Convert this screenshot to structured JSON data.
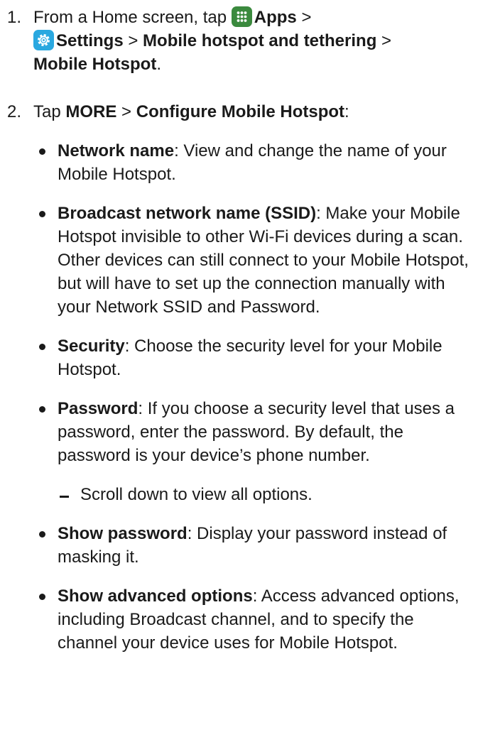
{
  "steps": [
    {
      "number": "1.",
      "intro": "From a Home screen, tap",
      "apps_label": "Apps",
      "sep1": " > ",
      "settings_label": "Settings",
      "sep2": " > ",
      "path3": "Mobile hotspot and tethering",
      "sep3": " > ",
      "path4": "Mobile Hotspot",
      "end": "."
    },
    {
      "number": "2.",
      "intro": "Tap ",
      "more": "MORE",
      "sep": " > ",
      "configure": "Configure Mobile Hotspot",
      "end": ":"
    }
  ],
  "icons": {
    "apps": "apps-grid-icon",
    "settings": "gear-icon"
  },
  "colors": {
    "apps_icon": "#3b8a3e",
    "settings_icon": "#2aa8e0"
  },
  "options": [
    {
      "term": "Network name",
      "desc": ": View and change the name of your Mobile Hotspot."
    },
    {
      "term": "Broadcast network name (SSID)",
      "desc": ": Make your Mobile Hotspot invisible to other Wi-Fi devices during a scan. Other devices can still connect to your Mobile Hotspot, but will have to set up the connection manually with your Network SSID and Password."
    },
    {
      "term": "Security",
      "desc": ": Choose the security level for your Mobile Hotspot."
    },
    {
      "term": "Password",
      "desc": ": If you choose a security level that uses a password, enter the password. By default, the password is your device’s phone number."
    }
  ],
  "note": "Scroll down to view all options.",
  "options_more": [
    {
      "term": "Show password",
      "desc": ": Display your password instead of masking it."
    },
    {
      "term": "Show advanced options",
      "desc": ": Access advanced options, including Broadcast channel, and to specify the channel your device uses for Mobile Hotspot."
    }
  ]
}
